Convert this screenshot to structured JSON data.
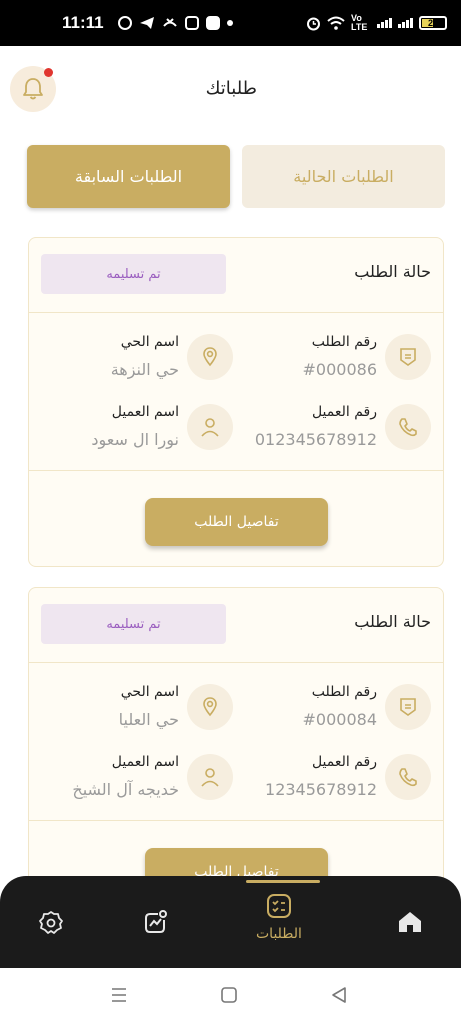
{
  "status_bar": {
    "time": "11:11",
    "network_label": "Vo LTE",
    "battery_level": "29"
  },
  "header": {
    "title": "طلباتك"
  },
  "tabs": {
    "previous": "الطلبات السابقة",
    "current": "الطلبات الحالية"
  },
  "orders": [
    {
      "status_label": "حالة الطلب",
      "status_value": "تم تسليمه",
      "order_number_label": "رقم الطلب",
      "order_number": "#000086",
      "district_label": "اسم الحي",
      "district": "حي النزهة",
      "client_number_label": "رقم العميل",
      "client_number": "012345678912",
      "client_name_label": "اسم العميل",
      "client_name": "نورا ال سعود",
      "details_button": "تفاصيل الطلب"
    },
    {
      "status_label": "حالة الطلب",
      "status_value": "تم تسليمه",
      "order_number_label": "رقم الطلب",
      "order_number": "#000084",
      "district_label": "اسم الحي",
      "district": "حي العليا",
      "client_number_label": "رقم العميل",
      "client_number": "12345678912",
      "client_name_label": "اسم العميل",
      "client_name": "خديجه آل الشيخ",
      "details_button": "تفاصيل الطلب"
    }
  ],
  "bottom_nav": {
    "orders_label": "الطلبات",
    "items": [
      "home-icon",
      "orders-icon",
      "stats-icon",
      "settings-icon"
    ]
  },
  "colors": {
    "accent_gold": "#c9ad62",
    "card_bg": "#fffcf4",
    "badge_bg": "#efe6f0",
    "badge_text": "#9b5fc0",
    "nav_bg": "#1b1b1b",
    "notification_dot": "#e0362f"
  }
}
